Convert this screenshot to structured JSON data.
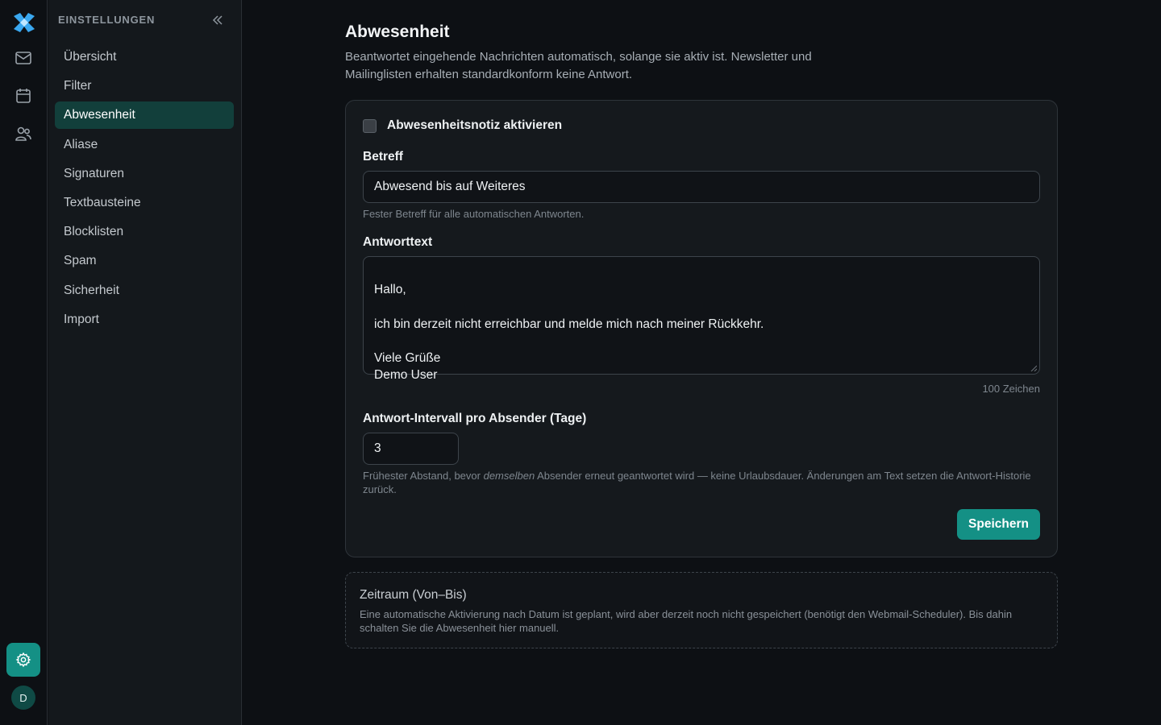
{
  "rail": {
    "avatar_initial": "D",
    "colors": {
      "accent": "#149085",
      "logo_blue": "#3aa8f0"
    }
  },
  "sidebar": {
    "heading": "EINSTELLUNGEN",
    "items": [
      {
        "label": "Übersicht",
        "active": false
      },
      {
        "label": "Filter",
        "active": false
      },
      {
        "label": "Abwesenheit",
        "active": true
      },
      {
        "label": "Aliase",
        "active": false
      },
      {
        "label": "Signaturen",
        "active": false
      },
      {
        "label": "Textbausteine",
        "active": false
      },
      {
        "label": "Blocklisten",
        "active": false
      },
      {
        "label": "Spam",
        "active": false
      },
      {
        "label": "Sicherheit",
        "active": false
      },
      {
        "label": "Import",
        "active": false
      }
    ]
  },
  "page": {
    "title": "Abwesenheit",
    "subtitle": "Beantwortet eingehende Nachrichten automatisch, solange sie aktiv ist. Newsletter und Mailinglisten erhalten standardkonform keine Antwort."
  },
  "form": {
    "enable_label": "Abwesenheitsnotiz aktivieren",
    "enabled": false,
    "subject_label": "Betreff",
    "subject_value": "Abwesend bis auf Weiteres",
    "subject_hint": "Fester Betreff für alle automatischen Antworten.",
    "body_label": "Antworttext",
    "body_value": "Hallo,\n\nich bin derzeit nicht erreichbar und melde mich nach meiner Rückkehr.\n\nViele Grüße\nDemo User",
    "char_count": "100 Zeichen",
    "interval_label": "Antwort-Intervall pro Absender (Tage)",
    "interval_value": "3",
    "interval_hint_pre": "Frühester Abstand, bevor ",
    "interval_hint_em": "demselben",
    "interval_hint_post": " Absender erneut geantwortet wird — keine Urlaubsdauer. Änderungen am Text setzen die Antwort-Historie zurück.",
    "save_label": "Speichern"
  },
  "schedule": {
    "title": "Zeitraum (Von–Bis)",
    "text": "Eine automatische Aktivierung nach Datum ist geplant, wird aber derzeit noch nicht gespeichert (benötigt den Webmail-Scheduler). Bis dahin schalten Sie die Abwesenheit hier manuell."
  }
}
